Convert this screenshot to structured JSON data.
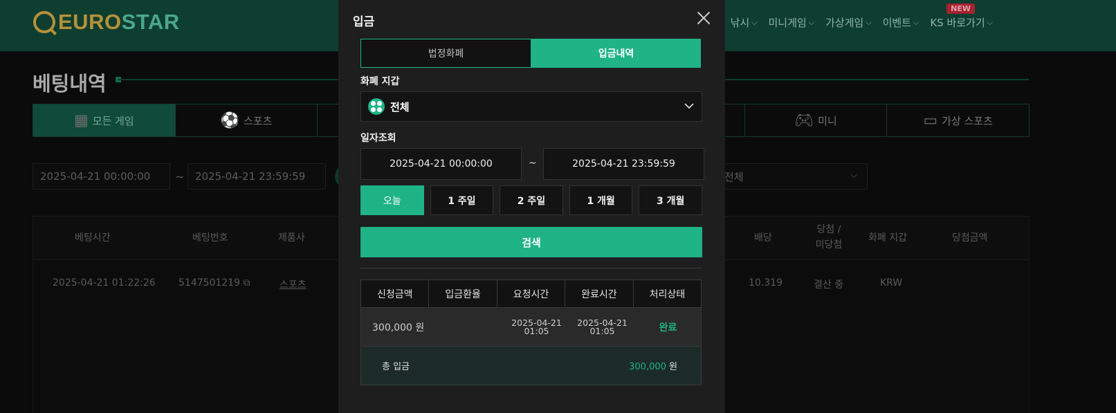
{
  "background": {
    "logo": {
      "euro": "EURO",
      "star": "STAR"
    },
    "nav": [
      "낚시",
      "미니게임",
      "가상게임",
      "이벤트",
      "KS 바로가기"
    ],
    "new_badge": "NEW",
    "page_title": "베팅내역",
    "category_tabs": [
      "모든 게임",
      "스포츠",
      "",
      "",
      "",
      "미니",
      "가상 스포츠"
    ],
    "date_from": "2025-04-21 00:00:00",
    "date_to": "2025-04-21 23:59:59",
    "tilde": "~",
    "filter_select": "전체",
    "table_headers": [
      "베팅시간",
      "베팅번호",
      "제품사",
      "배당",
      "당첨 / 미당첨",
      "화폐 지갑",
      "당첨금액"
    ],
    "row": {
      "time": "2025-04-21 01:22:26",
      "bet_no": "5147501219",
      "provider": "스포츠",
      "odds": "10.319",
      "result": "결산 중",
      "wallet": "KRW"
    }
  },
  "modal": {
    "title": "입금",
    "tabs": [
      "법정화폐",
      "입금내역"
    ],
    "active_tab": "입금내역",
    "wallet_label": "화폐 지갑",
    "wallet_value": "전체",
    "date_label": "일자조회",
    "date_from": "2025-04-21 00:00:00",
    "date_to": "2025-04-21 23:59:59",
    "tilde": "~",
    "periods": [
      "오늘",
      "1 주일",
      "2 주일",
      "1 개월",
      "3 개월"
    ],
    "active_period": "오늘",
    "search_label": "검색",
    "table": {
      "headers": [
        "신청금액",
        "입금환율",
        "요청시간",
        "완료시간",
        "처리상태"
      ],
      "rows": [
        {
          "amount": "300,000 원",
          "rate": "",
          "requested_date": "2025-04-21",
          "requested_time": "01:05",
          "completed_date": "2025-04-21",
          "completed_time": "01:05",
          "status": "완료"
        }
      ],
      "total_label": "총 입금",
      "total_amount": "300,000",
      "total_unit": "원"
    }
  },
  "colors": {
    "accent": "#1fb386",
    "modal_bg": "#1e1e1e",
    "topbar": "#0e3e30"
  }
}
